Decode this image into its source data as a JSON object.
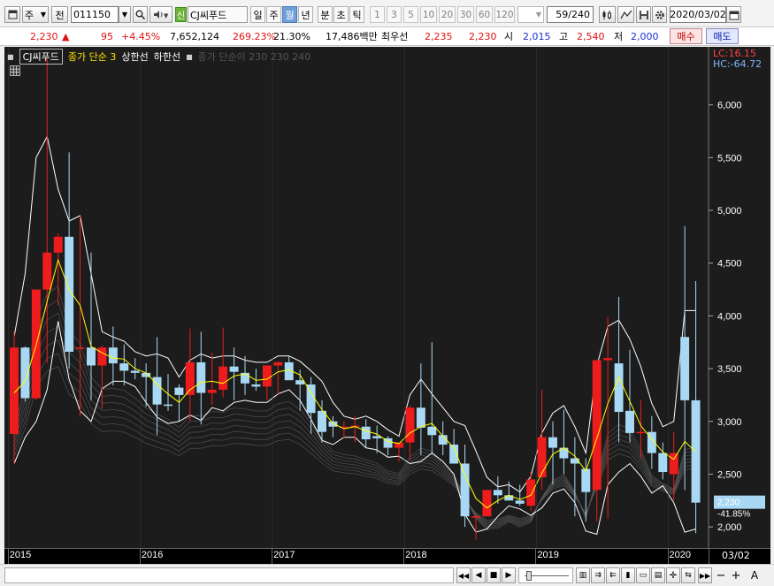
{
  "toolbar": {
    "market_type": "주",
    "prev_label": "전",
    "stock_code": "011150",
    "badge": "신",
    "stock_name": "CJ씨푸드",
    "periods": [
      "일",
      "주",
      "월",
      "년",
      "분",
      "초",
      "틱"
    ],
    "active_period": "월",
    "intervals": [
      "1",
      "3",
      "5",
      "10",
      "20",
      "30",
      "60",
      "120"
    ],
    "count_display": "59/240",
    "date": "2020/03/02"
  },
  "quote": {
    "price": "2,230",
    "arrow": "▲",
    "change": "95",
    "change_pct": "+4.45%",
    "volume": "7,652,124",
    "volume_ratio": "269.23%",
    "turnover": "21.30%",
    "amount": "17,486백만",
    "best_label": "최우선",
    "best_ask": "2,235",
    "best_bid": "2,230",
    "open_label": "시",
    "open": "2,015",
    "high_label": "고",
    "high": "2,540",
    "low_label": "저",
    "low": "2,000",
    "buy_label": "매수",
    "sell_label": "매도"
  },
  "legend": {
    "name": "CJ씨푸드",
    "ma_label": "종가 단순 3",
    "upper_label": "상한선",
    "lower_label": "하한선",
    "ma_group_label": "종가 단순이 230 230 240"
  },
  "price_axis": {
    "lc_label": "LC:16.15",
    "hc_label": "HC:-64.72",
    "ticks": [
      "6,000",
      "5,500",
      "5,000",
      "4,500",
      "4,000",
      "3,500",
      "3,000",
      "2,500",
      "2,000"
    ],
    "current_price_tag": "2,230",
    "current_pct_tag": "-41.85%"
  },
  "time_axis": {
    "year_labels": [
      "2015",
      "2016",
      "2017",
      "2018",
      "2019",
      "2020"
    ],
    "end_label": "03/02"
  },
  "colors": {
    "up": "#ee1c1c",
    "down": "#a8d8f4",
    "ma": "#ffff00",
    "band": "#ffffff",
    "background": "#1c1c1c"
  },
  "chart_data": {
    "type": "candlestick",
    "interval": "monthly",
    "x": [
      "2015-01",
      "2015-02",
      "2015-03",
      "2015-04",
      "2015-05",
      "2015-06",
      "2015-07",
      "2015-08",
      "2015-09",
      "2015-10",
      "2015-11",
      "2015-12",
      "2016-01",
      "2016-02",
      "2016-03",
      "2016-04",
      "2016-05",
      "2016-06",
      "2016-07",
      "2016-08",
      "2016-09",
      "2016-10",
      "2016-11",
      "2016-12",
      "2017-01",
      "2017-02",
      "2017-03",
      "2017-04",
      "2017-05",
      "2017-06",
      "2017-07",
      "2017-08",
      "2017-09",
      "2017-10",
      "2017-11",
      "2017-12",
      "2018-01",
      "2018-02",
      "2018-03",
      "2018-04",
      "2018-05",
      "2018-06",
      "2018-07",
      "2018-08",
      "2018-09",
      "2018-10",
      "2018-11",
      "2018-12",
      "2019-01",
      "2019-02",
      "2019-03",
      "2019-04",
      "2019-05",
      "2019-06",
      "2019-07",
      "2019-08",
      "2019-09",
      "2019-10",
      "2019-11",
      "2019-12",
      "2020-01",
      "2020-02",
      "2020-03"
    ],
    "open": [
      2880,
      3700,
      3220,
      4250,
      4600,
      4750,
      3690,
      3700,
      3530,
      3700,
      3550,
      3480,
      3460,
      3420,
      3160,
      3320,
      3250,
      3560,
      3270,
      3300,
      3520,
      3460,
      3350,
      3330,
      3530,
      3560,
      3390,
      3350,
      3100,
      3000,
      2950,
      2950,
      2950,
      2860,
      2840,
      2750,
      2800,
      3130,
      2950,
      2870,
      2780,
      2600,
      2100,
      2100,
      2350,
      2300,
      2250,
      2200,
      2470,
      2850,
      2750,
      2650,
      2550,
      2350,
      3580,
      3550,
      3100,
      2900,
      2900,
      2700,
      2500,
      3800,
      3200
    ],
    "high": [
      3850,
      3710,
      3800,
      6450,
      4780,
      5550,
      4950,
      4600,
      3720,
      3900,
      3730,
      3600,
      3550,
      3800,
      3450,
      3350,
      3880,
      3850,
      3650,
      3890,
      3700,
      3620,
      3500,
      3450,
      3570,
      3620,
      3490,
      3420,
      3200,
      3050,
      3000,
      3050,
      3020,
      2960,
      2860,
      2770,
      3150,
      3550,
      3750,
      3000,
      2930,
      2780,
      2120,
      2330,
      2480,
      2430,
      2400,
      2520,
      3300,
      3000,
      3110,
      2850,
      2650,
      3400,
      3990,
      4180,
      3680,
      3200,
      3050,
      2800,
      2900,
      4850,
      4330
    ],
    "low": [
      2600,
      3190,
      3200,
      3550,
      4100,
      3500,
      3050,
      3200,
      3120,
      3340,
      3340,
      3400,
      3140,
      2870,
      3100,
      3000,
      3000,
      2970,
      3160,
      3230,
      3200,
      3250,
      3290,
      3200,
      3250,
      3420,
      3100,
      2880,
      2800,
      2850,
      2840,
      2800,
      2750,
      2700,
      2680,
      2620,
      2640,
      2680,
      2700,
      2680,
      2660,
      2000,
      1880,
      2150,
      2220,
      2270,
      2200,
      2150,
      2350,
      2400,
      2500,
      2100,
      2050,
      2050,
      2080,
      2800,
      2800,
      2650,
      2550,
      2450,
      2250,
      2350,
      1940
    ],
    "close": [
      3700,
      3220,
      4250,
      4600,
      4750,
      3660,
      3700,
      3530,
      3700,
      3550,
      3480,
      3460,
      3420,
      3160,
      3150,
      3250,
      3560,
      3270,
      3300,
      3520,
      3470,
      3360,
      3330,
      3530,
      3560,
      3390,
      3350,
      3080,
      2900,
      2950,
      2950,
      2960,
      2830,
      2840,
      2750,
      2800,
      3130,
      2940,
      2870,
      2780,
      2600,
      2100,
      2100,
      2350,
      2300,
      2250,
      2220,
      2450,
      2850,
      2750,
      2650,
      2600,
      2330,
      3580,
      3600,
      3090,
      2890,
      2900,
      2700,
      2520,
      2700,
      3200,
      2230
    ],
    "ma3": [
      3270,
      3380,
      3720,
      4140,
      4530,
      4250,
      4100,
      3710,
      3650,
      3600,
      3590,
      3500,
      3460,
      3350,
      3260,
      3180,
      3300,
      3370,
      3380,
      3360,
      3430,
      3450,
      3390,
      3400,
      3470,
      3490,
      3440,
      3270,
      3110,
      2980,
      2930,
      2950,
      2910,
      2880,
      2810,
      2790,
      2890,
      2950,
      2980,
      2860,
      2750,
      2490,
      2270,
      2180,
      2250,
      2300,
      2260,
      2300,
      2510,
      2690,
      2750,
      2670,
      2530,
      2840,
      3170,
      3420,
      3190,
      2960,
      2830,
      2710,
      2640,
      2810,
      2710
    ],
    "upper": [
      3800,
      4400,
      5500,
      5700,
      5200,
      4900,
      4950,
      4400,
      3850,
      3800,
      3760,
      3660,
      3620,
      3640,
      3600,
      3420,
      3580,
      3640,
      3600,
      3620,
      3620,
      3580,
      3560,
      3560,
      3620,
      3620,
      3570,
      3480,
      3380,
      3180,
      3050,
      3020,
      3050,
      3000,
      2920,
      2860,
      3250,
      3400,
      3260,
      3130,
      3000,
      2960,
      2720,
      2470,
      2380,
      2400,
      2330,
      2480,
      2890,
      3080,
      3150,
      2950,
      2700,
      3530,
      3900,
      3960,
      3780,
      3520,
      3170,
      2950,
      3000,
      4050,
      4050
    ],
    "lower": [
      2600,
      2850,
      3000,
      3300,
      3950,
      3400,
      3100,
      3000,
      3310,
      3380,
      3380,
      3330,
      3180,
      3040,
      2980,
      3000,
      3060,
      3010,
      3130,
      3100,
      3180,
      3200,
      3180,
      3180,
      3260,
      3300,
      3200,
      3020,
      2820,
      2780,
      2850,
      2850,
      2750,
      2730,
      2660,
      2670,
      2600,
      2620,
      2700,
      2620,
      2500,
      2120,
      1950,
      1980,
      2100,
      2200,
      2170,
      2110,
      2180,
      2320,
      2360,
      2230,
      1960,
      1930,
      2400,
      2520,
      2600,
      2480,
      2320,
      2390,
      2230,
      1950,
      1980
    ],
    "ylim": [
      1800,
      6550
    ]
  }
}
